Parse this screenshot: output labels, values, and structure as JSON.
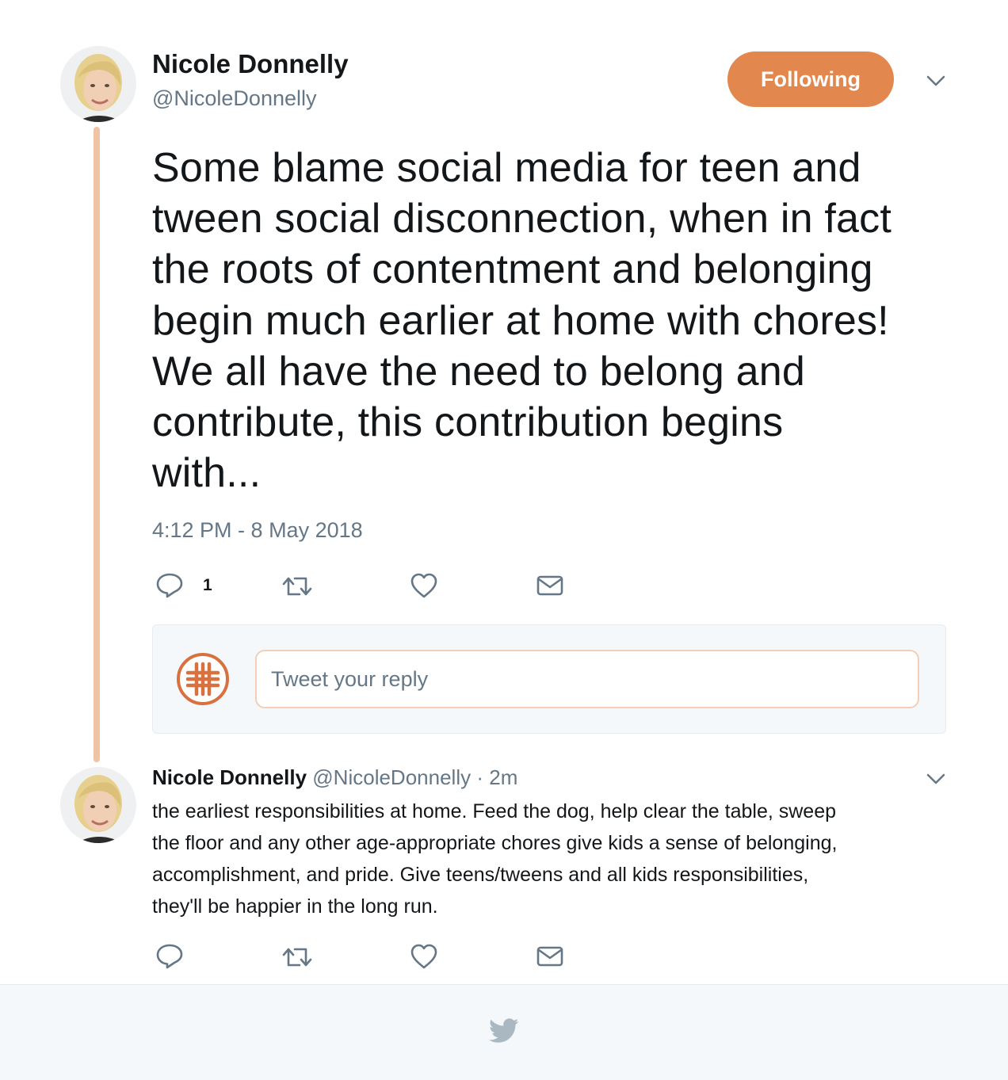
{
  "main_tweet": {
    "author_name": "Nicole Donnelly",
    "author_handle": "@NicoleDonnelly",
    "follow_label": "Following",
    "text_lines": [
      "Some blame social media for teen and",
      "tween social disconnection, when in fact",
      "the roots of contentment and belonging",
      "begin much earlier at home with chores!",
      "We all have the need to belong and",
      "contribute, this contribution begins",
      "with..."
    ],
    "timestamp": "4:12 PM - 8 May 2018",
    "actions": {
      "reply_count": "1",
      "reply_icon": "reply-icon",
      "retweet_icon": "retweet-icon",
      "like_icon": "heart-icon",
      "dm_icon": "envelope-icon"
    }
  },
  "reply_composer": {
    "placeholder": "Tweet your reply",
    "avatar_icon": "hashtag-logo"
  },
  "reply_tweet": {
    "author_name": "Nicole Donnelly",
    "author_handle": "@NicoleDonnelly",
    "separator": "·",
    "time": "2m",
    "text_lines": [
      "the earliest responsibilities at home. Feed the dog, help clear the table, sweep",
      "the floor and any other age-appropriate chores give kids a sense of belonging,",
      "accomplishment, and pride. Give teens/tweens and all kids responsibilities,",
      "they'll be happier in the long run."
    ]
  },
  "footer": {
    "icon": "twitter-bird-icon"
  },
  "colors": {
    "accent": "#e2884f",
    "thread_line": "#efc3a3",
    "secondary_text": "#657786",
    "icon_gray": "#657786"
  }
}
